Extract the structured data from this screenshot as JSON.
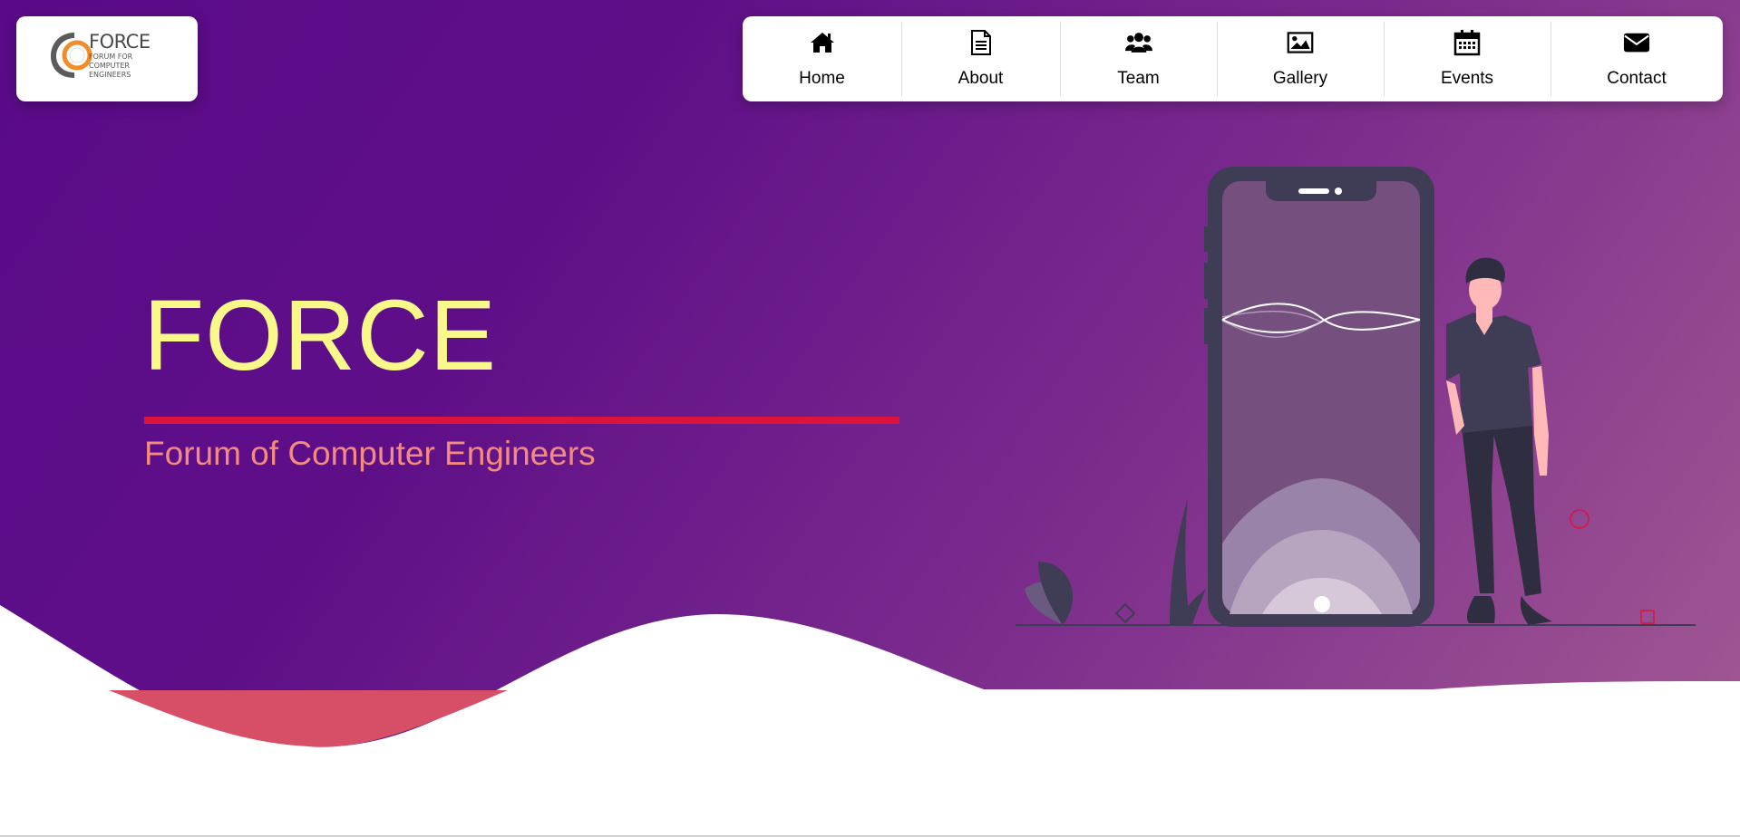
{
  "brand": {
    "logo_word": "FORCE",
    "logo_sub": "Forum for Computer Engineers",
    "logo_icon": "force-logo-mark"
  },
  "nav": {
    "items": [
      {
        "label": "Home",
        "icon": "home-icon"
      },
      {
        "label": "About",
        "icon": "document-icon"
      },
      {
        "label": "Team",
        "icon": "users-icon"
      },
      {
        "label": "Gallery",
        "icon": "image-icon"
      },
      {
        "label": "Events",
        "icon": "calendar-icon"
      },
      {
        "label": "Contact",
        "icon": "envelope-icon"
      }
    ]
  },
  "hero": {
    "title": "FORCE",
    "subtitle": "Forum of Computer Engineers"
  },
  "colors": {
    "hero_gradient_start": "#5a0a87",
    "hero_gradient_end": "#a35b93",
    "title": "#f9f98a",
    "rule": "#dc143c",
    "subtitle": "#f38b80",
    "wave_accent": "#d64f67",
    "logo_accent": "#f28c28"
  }
}
